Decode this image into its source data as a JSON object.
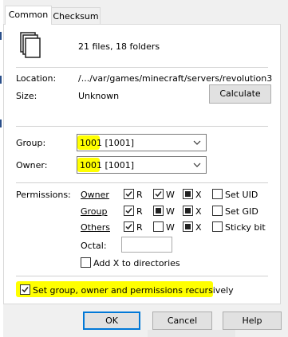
{
  "tabs": [
    {
      "label": "Common"
    },
    {
      "label": "Checksum"
    }
  ],
  "summary": {
    "text": "21 files, 18 folders"
  },
  "location": {
    "label": "Location:",
    "value": "/.../var/games/minecraft/servers/revolution3"
  },
  "size": {
    "label": "Size:",
    "value": "Unknown",
    "calculate_label": "Calculate"
  },
  "group": {
    "label": "Group:",
    "value_highlight": "1001",
    "value_rest": " [1001]"
  },
  "owner": {
    "label": "Owner:",
    "value_highlight": "1001",
    "value_rest": " [1001]"
  },
  "permissions": {
    "label": "Permissions:",
    "rows": [
      {
        "name": "Owner",
        "r": "R",
        "w": "W",
        "x": "X",
        "special": "Set UID"
      },
      {
        "name": "Group",
        "r": "R",
        "w": "W",
        "x": "X",
        "special": "Set GID"
      },
      {
        "name": "Others",
        "r": "R",
        "w": "W",
        "x": "X",
        "special": "Sticky bit"
      }
    ],
    "octal_label": "Octal:",
    "add_x_label": "Add X to directories"
  },
  "recursive": {
    "label": "Set group, owner and permissions recursively"
  },
  "buttons": {
    "ok": "OK",
    "cancel": "Cancel",
    "help": "Help"
  },
  "colors": {
    "highlight": "#ffff00",
    "accent": "#0078d7"
  },
  "icons": [
    "files-icon",
    "chevron-down-icon",
    "check-icon"
  ]
}
